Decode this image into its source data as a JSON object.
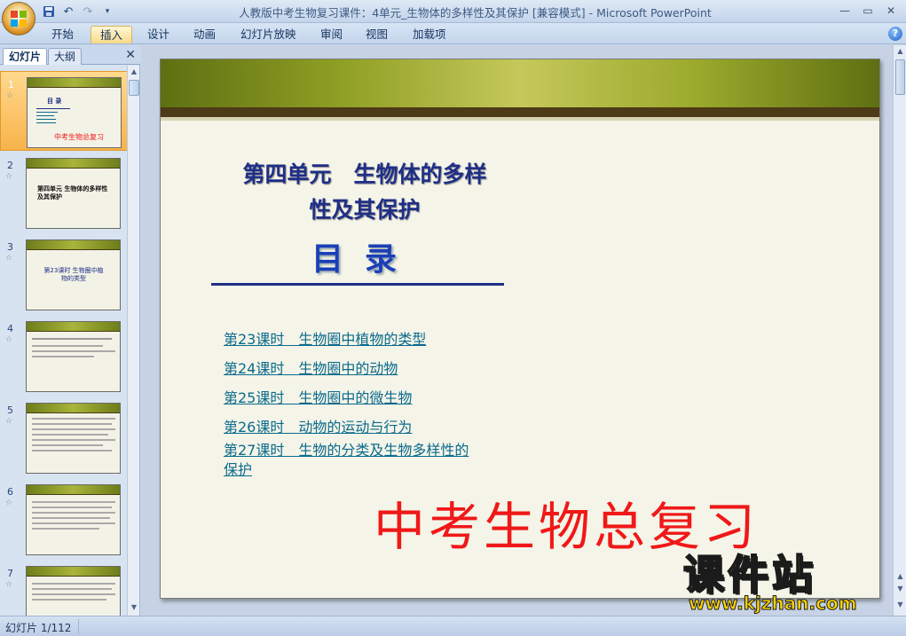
{
  "window": {
    "title": "人教版中考生物复习课件：4单元_生物体的多样性及其保护 [兼容模式] - Microsoft PowerPoint"
  },
  "quick_access": {
    "icons": [
      "save-icon",
      "undo-icon",
      "redo-icon",
      "customize-icon"
    ]
  },
  "ribbon": {
    "tabs": [
      {
        "label": "开始"
      },
      {
        "label": "插入"
      },
      {
        "label": "设计"
      },
      {
        "label": "动画"
      },
      {
        "label": "幻灯片放映"
      },
      {
        "label": "审阅"
      },
      {
        "label": "视图"
      },
      {
        "label": "加载项"
      }
    ],
    "active_tab": "插入"
  },
  "left_pane": {
    "tabs": [
      {
        "label": "幻灯片"
      },
      {
        "label": "大纲"
      }
    ],
    "close_glyph": "✕",
    "thumbnails": [
      {
        "number": "1",
        "caption": "中考生物总复习",
        "heading": "目 录"
      },
      {
        "number": "2",
        "caption": "第四单元 生物体的多样性及其保护"
      },
      {
        "number": "3",
        "caption": "第23课时 生物圈中植物的类型"
      },
      {
        "number": "4",
        "caption": ""
      },
      {
        "number": "5",
        "caption": ""
      },
      {
        "number": "6",
        "caption": ""
      },
      {
        "number": "7",
        "caption": ""
      }
    ]
  },
  "slide": {
    "title_line1": "第四单元　生物体的多样",
    "title_line2": "性及其保护",
    "mulu": "目录",
    "toc": [
      "第23课时　生物圈中植物的类型",
      "第24课时　生物圈中的动物",
      "第25课时　生物圈中的微生物",
      "第26课时　动物的运动与行为",
      "第27课时　生物的分类及生物多样性的",
      "保护"
    ],
    "red_title": "中考生物总复习"
  },
  "watermark": {
    "big": "课件站",
    "small": "www.kjzhan.com"
  },
  "status": {
    "slide_counter": "幻灯片 1/112"
  },
  "colors": {
    "accent_selected": "#f8b34a",
    "slide_title": "#1f2e86",
    "toc_link": "#0b6a8c",
    "red_title": "#f01818",
    "band_green": "#8f9f24"
  }
}
